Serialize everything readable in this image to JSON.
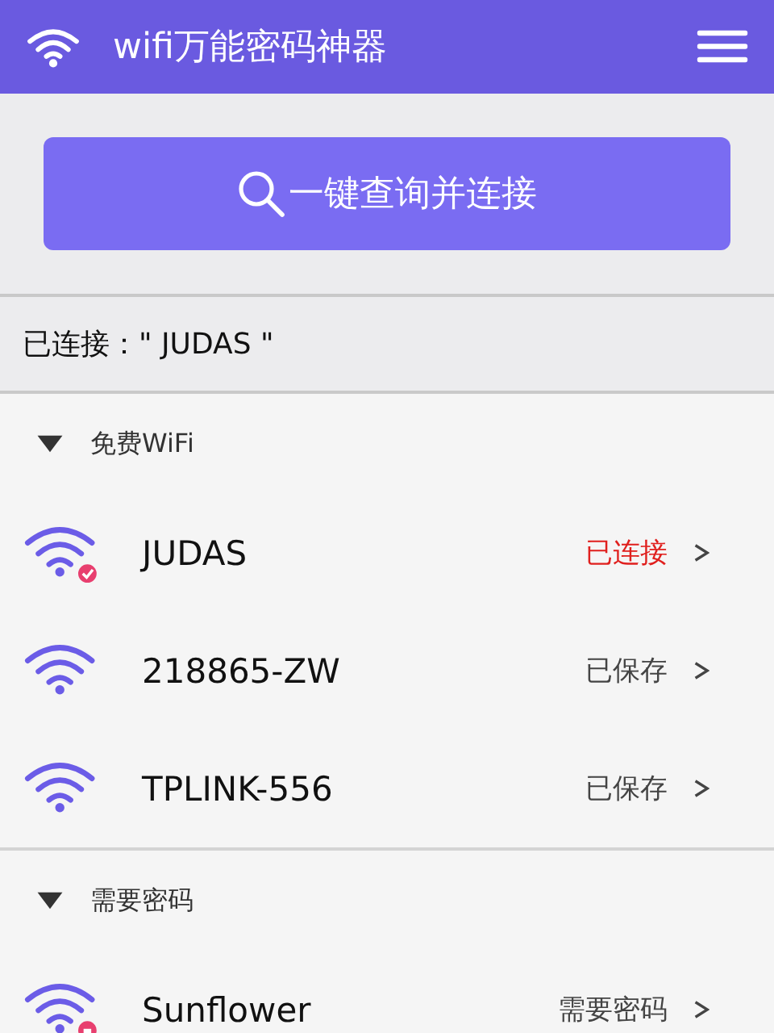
{
  "header": {
    "title": "wifi万能密码神器"
  },
  "scan_button": {
    "label": "一键查询并连接"
  },
  "connected_bar": {
    "text": "已连接：\" JUDAS \""
  },
  "groups": [
    {
      "title": "免费WiFi",
      "expanded": true,
      "networks": [
        {
          "name": "JUDAS",
          "status": "已连接",
          "kind": "connected"
        },
        {
          "name": "218865-ZW",
          "status": "已保存",
          "kind": "saved"
        },
        {
          "name": "TPLINK-556",
          "status": "已保存",
          "kind": "saved"
        }
      ]
    },
    {
      "title": "需要密码",
      "expanded": true,
      "networks": [
        {
          "name": "Sunflower",
          "status": "需要密码",
          "kind": "locked"
        }
      ]
    }
  ]
}
